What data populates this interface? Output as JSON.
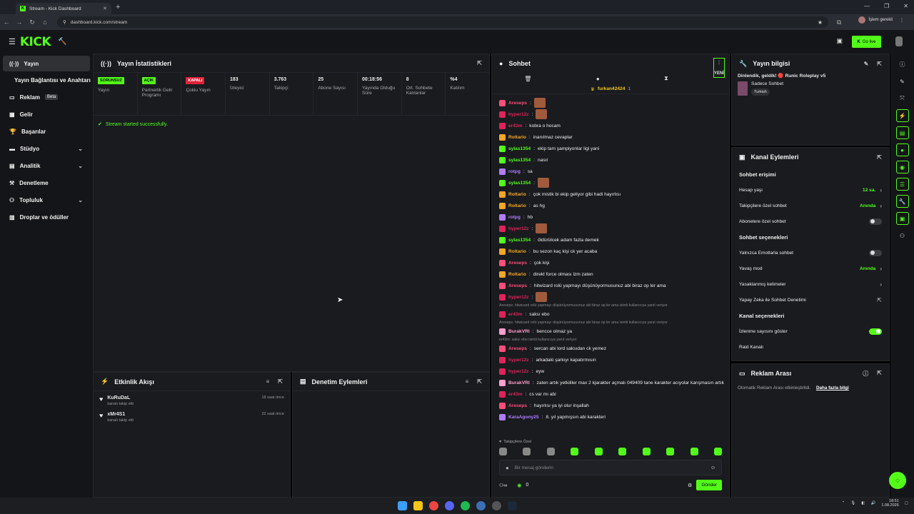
{
  "browser": {
    "tab_title": "Stream - Kick Dashboard",
    "url": "dashboard.kick.com/stream",
    "profile_label": "İşlem gerekli"
  },
  "header": {
    "logo": "KICK",
    "go_live": "Go live"
  },
  "sidebar": {
    "items": [
      {
        "label": "Yayın",
        "icon": "stream-icon"
      },
      {
        "label": "Yayın Bağlantısı ve Anahtarı",
        "icon": ""
      },
      {
        "label": "Reklam",
        "badge": "Beta",
        "icon": "ad-icon"
      },
      {
        "label": "Gelir",
        "icon": "money-icon"
      },
      {
        "label": "Başarılar",
        "icon": "trophy-icon"
      },
      {
        "label": "Stüdyo",
        "icon": "studio-icon"
      },
      {
        "label": "Analitik",
        "icon": "chart-icon"
      },
      {
        "label": "Denetleme",
        "icon": "hammer-icon"
      },
      {
        "label": "Topluluk",
        "icon": "community-icon"
      },
      {
        "label": "Droplar ve ödüller",
        "icon": "gift-icon"
      }
    ]
  },
  "stats_panel": {
    "title": "Yayın İstatistikleri",
    "stats": [
      {
        "tag": "SORUNSUZ",
        "tag_color": "#53fc18",
        "label": "Yayın"
      },
      {
        "tag": "AÇIK",
        "tag_color": "#53fc18",
        "label": "Partnerlik Gelir Programı"
      },
      {
        "tag": "KAPALI",
        "tag_color": "#e0233a",
        "label": "Çoklu Yayın"
      },
      {
        "value": "183",
        "label": "İzleyici"
      },
      {
        "value": "3.763",
        "label": "Takipçi"
      },
      {
        "value": "25",
        "label": "Abone Sayısı"
      },
      {
        "value": "00:18:56",
        "label": "Yayında Olduğu Süre"
      },
      {
        "value": "8",
        "label": "Ort. Sohbete Katılanlar"
      },
      {
        "value": "%4",
        "label": "Katılım"
      }
    ],
    "status_message": "Stream started successfully."
  },
  "activity_panel": {
    "title": "Etkinlik Akışı",
    "events": [
      {
        "user": "KuRuDaL",
        "action": "kanalı takip etti",
        "time": "18 saat önce"
      },
      {
        "user": "xMr4S1",
        "action": "kanalı takip etti",
        "time": "22 saat önce"
      }
    ]
  },
  "moderation_panel": {
    "title": "Denetim Eylemleri"
  },
  "chat": {
    "title": "Sohbet",
    "new_label": "YENİ",
    "pinned_user": "furkan42424",
    "pinned_count": "1",
    "lines": [
      {
        "type": "msg",
        "user": "Areseps",
        "color": "#ff4d7a",
        "text": "",
        "emote": true
      },
      {
        "type": "msg",
        "user": "hyper12z",
        "color": "#e0235a",
        "text": "",
        "emote": true
      },
      {
        "type": "msg",
        "user": "er43m",
        "color": "#e0235a",
        "text": "kobra o hocam"
      },
      {
        "type": "msg",
        "user": "Roltario",
        "color": "#f5a623",
        "text": "inanılmaz cevaplar"
      },
      {
        "type": "msg",
        "user": "sylas1354",
        "color": "#53fc18",
        "text": "ekip tam şampiyonlar ligi yani"
      },
      {
        "type": "msg",
        "user": "sylas1354",
        "color": "#53fc18",
        "text": "nasıl"
      },
      {
        "type": "msg",
        "user": "rotpg",
        "color": "#b07cff",
        "text": "sa"
      },
      {
        "type": "msg",
        "user": "sylas1354",
        "color": "#53fc18",
        "text": "",
        "emote": true
      },
      {
        "type": "msg",
        "user": "Roltario",
        "color": "#f5a623",
        "text": "çok mistik bi ekip geliyor gibi hadi hayırlısı"
      },
      {
        "type": "msg",
        "user": "Roltario",
        "color": "#f5a623",
        "text": "as hg"
      },
      {
        "type": "msg",
        "user": "rotpg",
        "color": "#b07cff",
        "text": "hb"
      },
      {
        "type": "msg",
        "user": "hyper12z",
        "color": "#e0235a",
        "text": "",
        "emote": true
      },
      {
        "type": "msg",
        "user": "sylas1354",
        "color": "#53fc18",
        "text": "öldürülcek adam fazla demek"
      },
      {
        "type": "msg",
        "user": "Roltario",
        "color": "#f5a623",
        "text": "bu sezon kaç kişi ck yer acaba"
      },
      {
        "type": "msg",
        "user": "Areseps",
        "color": "#ff4d7a",
        "text": "çok kişi"
      },
      {
        "type": "msg",
        "user": "Roltario",
        "color": "#f5a623",
        "text": "direkt force olması lzm zaten"
      },
      {
        "type": "msg",
        "user": "Areseps",
        "color": "#ff4d7a",
        "text": "hitwizard rolü yapmayı düşünüyormusunuz abi biraz op ler ama"
      },
      {
        "type": "msg",
        "user": "hyper12z",
        "color": "#e0235a",
        "text": "",
        "emote": true
      },
      {
        "type": "reply",
        "text": "Areseps: hitwizard rolü yapmayı düşünüyormusunuz abi biraz op ler ama isimli kullanıcıya yanıt veriyor"
      },
      {
        "type": "msg",
        "user": "er43m",
        "color": "#e0235a",
        "text": "saksı ebo"
      },
      {
        "type": "reply",
        "text": "Areseps: hitwizard rolü yapmayı düşünüyormusunuz abi biraz op ler ama isimli kullanıcıya yanıt veriyor"
      },
      {
        "type": "msg",
        "user": "BurakVRI",
        "color": "#ff9ecb",
        "text": "bencce olmaz ya"
      },
      {
        "type": "reply",
        "text": "er43m: saksı ebo isimli kullanıcıya yanıt veriyor"
      },
      {
        "type": "msg",
        "user": "Areseps",
        "color": "#ff4d7a",
        "text": "sercan abi lord saksıdan ck yemez"
      },
      {
        "type": "msg",
        "user": "hyper12z",
        "color": "#e0235a",
        "text": "arkadaki şarkıyı kapatırmısın"
      },
      {
        "type": "msg",
        "user": "hyper12z",
        "color": "#e0235a",
        "text": "eyw"
      },
      {
        "type": "msg",
        "user": "BurakVRI",
        "color": "#ff9ecb",
        "text": "zaten artık yetkililer max 2 kjarakter açmalı 049409 tane karakter acıyolar karışmasın artık"
      },
      {
        "type": "msg",
        "user": "er43m",
        "color": "#e0235a",
        "text": "cs var mı abi"
      },
      {
        "type": "msg",
        "user": "Areseps",
        "color": "#ff4d7a",
        "text": "hayırlısı ya iyi olur inşallah"
      },
      {
        "type": "msg",
        "user": "KaraAgony25",
        "color": "#b07cff",
        "text": "8. yıl yapmışsın abi karakteri"
      }
    ],
    "followers_only": "Takipçilere Özel",
    "input_placeholder": "Bir mesaj gönderin",
    "points": "0",
    "send_label": "Gönder"
  },
  "stream_info": {
    "title": "Yayın bilgisi",
    "stream_title": "Dinlendik, geldik! 🔴 Runic Roleplay v5",
    "category": "Sadece Sohbet",
    "language": "Turkish"
  },
  "channel_actions": {
    "title": "Kanal Eylemleri",
    "chat_access": "Sohbet erişimi",
    "account_age": "Hesap yaşı",
    "account_age_val": "12 sa.",
    "followers_chat": "Takipçilere özel sohbet",
    "followers_chat_val": "Anında",
    "subs_chat": "Abonelere özel sohbet",
    "chat_options": "Sohbet seçenekleri",
    "emotes_only": "Yalnızca Emotlarla sohbet",
    "slow_mode": "Yavaş mod",
    "slow_mode_val": "Anında",
    "banned_words": "Yasaklanmış kelimeler",
    "ai_moderation": "Yapay Zeka ile Sohbet Denetimi",
    "channel_options": "Kanal seçenekleri",
    "show_viewers": "İzlenme sayısını göster",
    "raid": "Raid Kanalı"
  },
  "ad_break": {
    "title": "Reklam Arası",
    "text": "Otomatik Reklam Arası etkinleştirildi.",
    "link": "Daha fazla bilgi"
  },
  "taskbar": {
    "time": "18:51",
    "date": "1.08.2026"
  },
  "colors": {
    "accent": "#53fc18",
    "panel": "#191b1f",
    "background": "#000000"
  }
}
